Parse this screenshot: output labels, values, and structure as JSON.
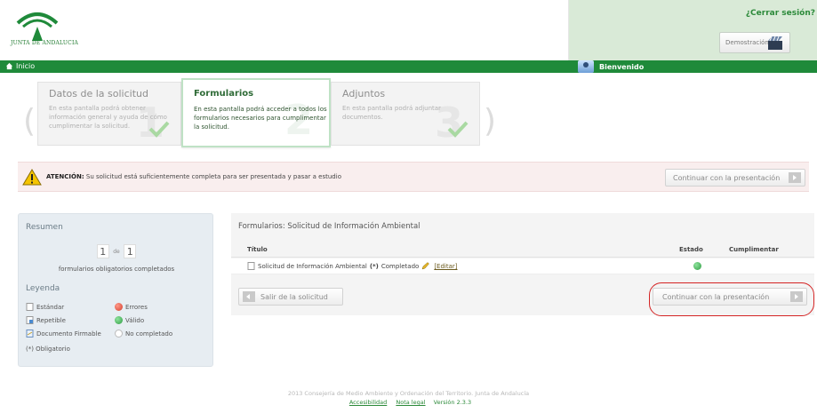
{
  "header": {
    "logo_text": "JUNTA DE ANDALUCIA",
    "logout_label": "¿Cerrar sesión?",
    "demo_label": "Demostración"
  },
  "navbar": {
    "home_label": "Inicio",
    "welcome_label": "Bienvenido"
  },
  "steps": [
    {
      "title": "Datos de la solicitud",
      "description": "En esta pantalla podrá obtener información general y ayuda de cómo cumplimentar la solicitud.",
      "number": "1",
      "active": false
    },
    {
      "title": "Formularios",
      "description": "En esta pantalla podrá acceder a todos los formularios necesarios para cumplimentar la solicitud.",
      "number": "2",
      "active": true
    },
    {
      "title": "Adjuntos",
      "description": "En esta pantalla podrá adjuntar documentos.",
      "number": "3",
      "active": false
    }
  ],
  "attention": {
    "label": "ATENCIÓN:",
    "message": "Su solicitud está suficientemente completa para ser presentada y pasar a estudio",
    "button_label": "Continuar con la presentación"
  },
  "summary": {
    "title": "Resumen",
    "completed": "1",
    "connector": "de",
    "total": "1",
    "caption": "formularios obligatorios completados",
    "legend_title": "Leyenda",
    "legend": {
      "standard": "Estándar",
      "repeatable": "Repetible",
      "signable": "Documento Firmable",
      "errors": "Errores",
      "valid": "Válido",
      "not_completed": "No completado",
      "mandatory": "(*) Obligatorio"
    }
  },
  "forms_panel": {
    "title": "Formularios: Solicitud de Información Ambiental",
    "columns": {
      "title": "Título",
      "status": "Estado",
      "fill": "Cumplimentar"
    },
    "rows": [
      {
        "name": "Solicitud de Información Ambiental",
        "mandatory_mark": "(*)",
        "state_text": "Completado",
        "edit_label": "[Editar]",
        "status": "valid"
      }
    ],
    "exit_button": "Salir de la solicitud",
    "continue_button": "Continuar con la presentación"
  },
  "footer": {
    "copyright": "2013 Consejería de Medio Ambiente y Ordenación del Territorio. Junta de Andalucía",
    "accessibility": "Accesibilidad",
    "legal": "Nota legal",
    "version": "Versión 2.3.3"
  },
  "colors": {
    "brand_green": "#1f8a3a",
    "header_right_bg": "#d9ead7",
    "attention_bg": "#f9eeee",
    "highlight_red": "#d42424"
  }
}
